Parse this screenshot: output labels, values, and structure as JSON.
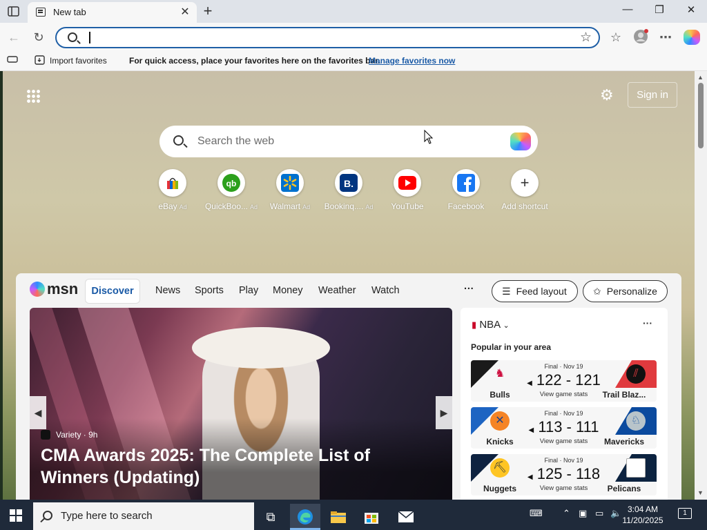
{
  "browser": {
    "tab_title": "New tab",
    "favorites_bar": {
      "import_label": "Import favorites",
      "message": "For quick access, place your favorites here on the favorites bar.",
      "manage_link": "Manage favorites now"
    }
  },
  "newtab": {
    "sign_in": "Sign in",
    "search_placeholder": "Search the web",
    "shortcuts": [
      {
        "label": "eBay",
        "ad": "Ad",
        "icon": "ebay-icon"
      },
      {
        "label": "QuickBoo...",
        "ad": "Ad",
        "icon": "quickbooks-icon"
      },
      {
        "label": "Walmart",
        "ad": "Ad",
        "icon": "walmart-icon"
      },
      {
        "label": "Bookinq....",
        "ad": "Ad",
        "icon": "booking-icon"
      },
      {
        "label": "YouTube",
        "ad": "",
        "icon": "youtube-icon"
      },
      {
        "label": "Facebook",
        "ad": "",
        "icon": "facebook-icon"
      },
      {
        "label": "Add shortcut",
        "ad": "",
        "icon": "plus-icon"
      }
    ]
  },
  "feed": {
    "logo": "msn",
    "tabs": [
      "Discover",
      "News",
      "Sports",
      "Play",
      "Money",
      "Weather",
      "Watch"
    ],
    "more": "···",
    "feed_layout": "Feed layout",
    "personalize": "Personalize",
    "hero": {
      "source": "Variety · 9h",
      "headline": "CMA Awards 2025: The Complete List of Winners (Updating)"
    },
    "nba": {
      "league": "NBA",
      "subtitle": "Popular in your area",
      "games": [
        {
          "status": "Final · Nov 19",
          "score": "122 - 121",
          "link": "View game stats",
          "home": "Bulls",
          "away": "Trail Blaz...",
          "home_color": "#1a1a1a",
          "away_color": "#e03a3e"
        },
        {
          "status": "Final · Nov 19",
          "score": "113 - 111",
          "link": "View game stats",
          "home": "Knicks",
          "away": "Mavericks",
          "home_color": "#1d64c2",
          "away_color": "#0b4a9e"
        },
        {
          "status": "Final · Nov 19",
          "score": "125 - 118",
          "link": "View game stats",
          "home": "Nuggets",
          "away": "Pelicans",
          "home_color": "#0e2240",
          "away_color": "#0c2340"
        }
      ]
    }
  },
  "taskbar": {
    "search_placeholder": "Type here to search",
    "time": "3:04 AM",
    "date": "11/20/2025",
    "notifications": "1"
  }
}
